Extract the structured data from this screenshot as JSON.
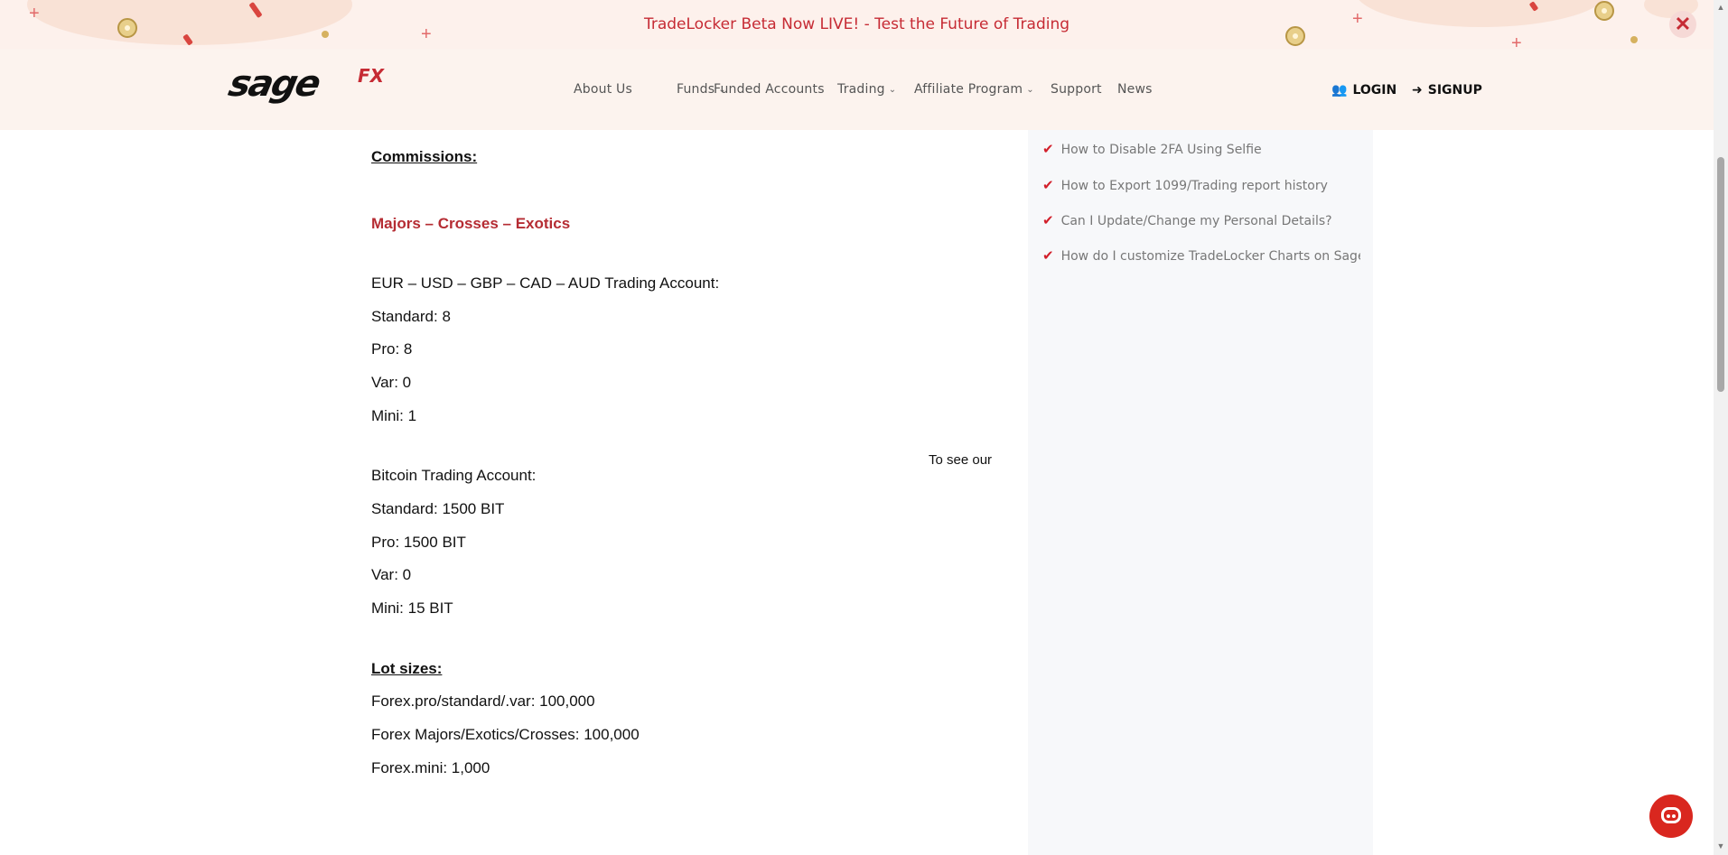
{
  "banner": {
    "text": "TradeLocker Beta Now LIVE! - Test the Future of Trading",
    "close_icon": "close-icon",
    "colors": {
      "background": "#fdf1ec",
      "text": "#c62b34"
    }
  },
  "header": {
    "logo_text": "sage",
    "logo_suffix": "FX",
    "nav": [
      {
        "label": "About Us",
        "has_dropdown": false
      },
      {
        "label": "Funds",
        "has_dropdown": true
      },
      {
        "label": "Funded Accounts",
        "has_dropdown": false
      },
      {
        "label": "Trading",
        "has_dropdown": true
      },
      {
        "label": "Affiliate Program",
        "has_dropdown": true
      },
      {
        "label": "Support",
        "has_dropdown": false
      },
      {
        "label": "News",
        "has_dropdown": false
      }
    ],
    "login": {
      "label": "LOGIN",
      "icon": "users-icon"
    },
    "signup": {
      "label": "SIGNUP",
      "icon": "sign-in-icon"
    }
  },
  "content": {
    "commissions_heading": "Commissions:",
    "category_heading": "Majors – Crosses – Exotics",
    "fx_account_title": "EUR – USD – GBP – CAD – AUD Trading Account:",
    "fx_rows": [
      "Standard: 8",
      "Pro: 8",
      "Var: 0",
      "Mini: 1"
    ],
    "side_note": "To see our",
    "btc_account_title": "Bitcoin Trading Account:",
    "btc_rows": [
      "Standard: 1500 BIT",
      "Pro: 1500  BIT",
      "Var: 0",
      "Mini: 15 BIT"
    ],
    "lot_heading": "Lot sizes:",
    "lot_rows": [
      "Forex.pro/standard/.var: 100,000",
      "Forex Majors/Exotics/Crosses: 100,000",
      "Forex.mini: 1,000"
    ]
  },
  "sidebar": {
    "links": [
      "How to Disable 2FA Using Selfie",
      "How to Export 1099/Trading report history",
      "Can I Update/Change my Personal Details?",
      "How do I customize TradeLocker Charts on SageFX"
    ],
    "icon": "check-icon"
  },
  "chat": {
    "icon": "chatbot-icon",
    "color": "#d9271f"
  }
}
